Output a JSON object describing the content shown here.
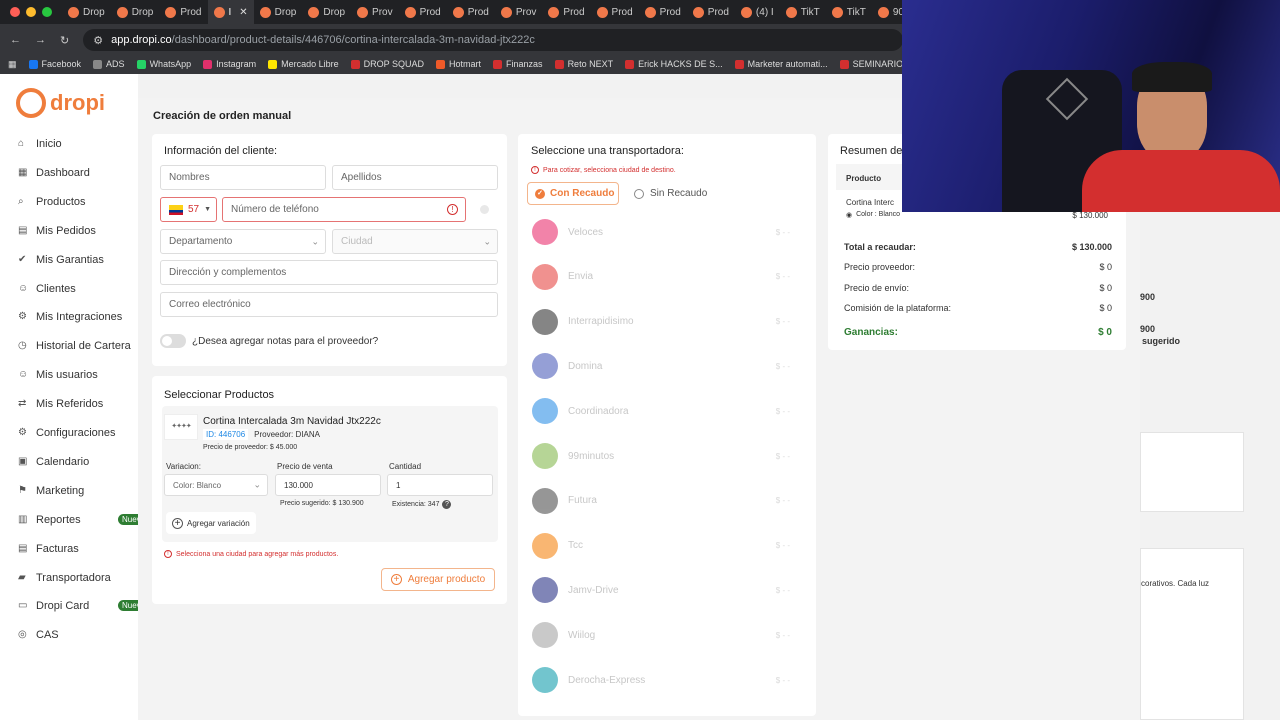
{
  "browser": {
    "tabs": [
      "Drop",
      "Drop",
      "Prod",
      "I",
      "Drop",
      "Drop",
      "Prov",
      "Prod",
      "Prod",
      "Prov",
      "Prod",
      "Prod",
      "Prod",
      "Prod",
      "(4) I",
      "TikT",
      "TikT",
      "90"
    ],
    "url_host": "app.dropi.co",
    "url_path": "/dashboard/product-details/446706/cortina-intercalada-3m-navidad-jtx222c",
    "bookmarks": [
      "Facebook",
      "ADS",
      "WhatsApp",
      "Instagram",
      "Mercado Libre",
      "DROP SQUAD",
      "Hotmart",
      "Finanzas",
      "Reto NEXT",
      "Erick HACKS DE S...",
      "Marketer automati...",
      "SEMINARIOS C"
    ]
  },
  "sidebar": {
    "logo": "dropi",
    "items": [
      "Inicio",
      "Dashboard",
      "Productos",
      "Mis Pedidos",
      "Mis Garantias",
      "Clientes",
      "Mis Integraciones",
      "Historial de Cartera",
      "Mis usuarios",
      "Mis Referidos",
      "Configuraciones",
      "Calendario",
      "Marketing",
      "Reportes",
      "Facturas",
      "Transportadora",
      "Dropi Card",
      "CAS"
    ],
    "badge_new": "Nuevo"
  },
  "modal": {
    "title": "Creación de orden manual",
    "client": {
      "title": "Información del cliente:",
      "nombres_ph": "Nombres",
      "apellidos_ph": "Apellidos",
      "country_code": "57",
      "phone_ph": "Número de teléfono",
      "departamento_ph": "Departamento",
      "ciudad_ph": "Ciudad",
      "direccion_ph": "Dirección y complementos",
      "email_ph": "Correo electrónico",
      "notes_label": "¿Desea agregar notas para el proveedor?"
    },
    "products": {
      "title": "Seleccionar Productos",
      "name": "Cortina Intercalada 3m Navidad Jtx222c",
      "id_label": "ID: 446706",
      "provider_label": "Proveedor: DIANA",
      "provider_price": "Precio de proveedor: $ 45.000",
      "variation_label": "Variacion:",
      "variation_value": "Color: Blanco",
      "sale_price_label": "Precio de venta",
      "sale_price_value": "130.000",
      "suggested_price": "Precio sugerido: $ 130.900",
      "qty_label": "Cantidad",
      "qty_value": "1",
      "stock": "Existencia: 347",
      "add_variation": "Agregar variación",
      "city_warning": "Selecciona una ciudad para agregar más productos.",
      "add_product": "Agregar producto"
    },
    "carriers": {
      "title": "Seleccione una transportadora:",
      "hint": "Para cotizar, selecciona ciudad de destino.",
      "opt_con": "Con Recaudo",
      "opt_sin": "Sin Recaudo",
      "price_placeholder": "$ - -",
      "list": [
        {
          "name": "Veloces",
          "color": "#e91e63"
        },
        {
          "name": "Envia",
          "color": "#e53935"
        },
        {
          "name": "Interrapidisimo",
          "color": "#222222"
        },
        {
          "name": "Domina",
          "color": "#3f51b5"
        },
        {
          "name": "Coordinadora",
          "color": "#1e88e5"
        },
        {
          "name": "99minutos",
          "color": "#7cb342"
        },
        {
          "name": "Futura",
          "color": "#424242"
        },
        {
          "name": "Tcc",
          "color": "#f57c00"
        },
        {
          "name": "Jamv-Drive",
          "color": "#1a237e"
        },
        {
          "name": "Wiilog",
          "color": "#9e9e9e"
        },
        {
          "name": "Derocha-Express",
          "color": "#0097a7"
        }
      ]
    },
    "summary": {
      "title": "Resumen de",
      "col_product": "Producto",
      "product_name": "Cortina Interc",
      "product_color": "Color : Blanco",
      "product_price": "$ 130.000",
      "rows": [
        {
          "label": "Total a recaudar:",
          "value": "$ 130.000"
        },
        {
          "label": "Precio proveedor:",
          "value": "$ 0"
        },
        {
          "label": "Precio de envío:",
          "value": "$ 0"
        },
        {
          "label": "Comisión de la plataforma:",
          "value": "$ 0"
        }
      ],
      "ganancias_label": "Ganancias:",
      "ganancias_value": "$ 0"
    }
  },
  "background": {
    "sugerido": "sugerido",
    "v1": "900",
    "v2": "900",
    "desc": "corativos. Cada luz"
  },
  "colors": {
    "accent": "#ef7d3c",
    "success": "#2e7d32",
    "error": "#d32f2f"
  }
}
